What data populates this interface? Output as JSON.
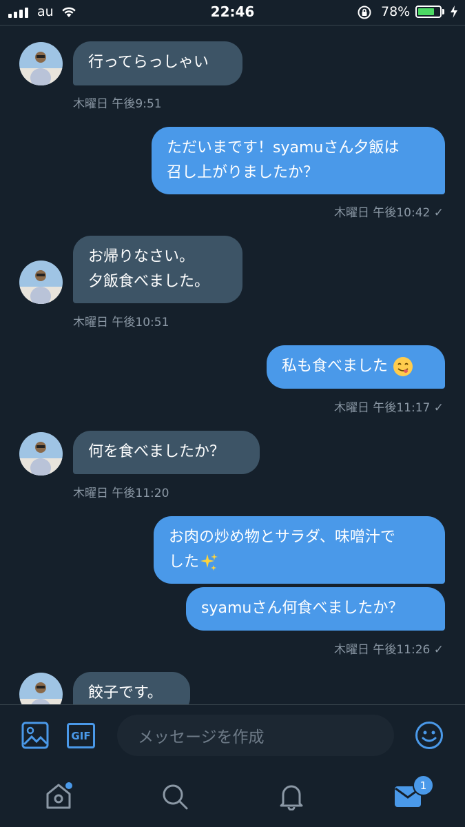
{
  "status_bar": {
    "carrier": "au",
    "time": "22:46",
    "battery": "78%",
    "battery_level": 0.78
  },
  "messages": [
    {
      "side": "in",
      "lines": [
        "行ってらっしゃい"
      ],
      "timestamp": "木曜日 午後9:51"
    },
    {
      "side": "out",
      "lines": [
        "ただいまです！syamuさん夕飯は",
        "召し上がりましたか？"
      ],
      "timestamp": "木曜日 午後10:42 ✓"
    },
    {
      "side": "in",
      "lines": [
        "お帰りなさい。",
        "夕飯食べました。"
      ],
      "timestamp": "木曜日 午後10:51"
    },
    {
      "side": "out",
      "lines": [
        "私も食べました"
      ],
      "emoji": "savoring-face-emoji",
      "timestamp": "木曜日 午後11:17 ✓"
    },
    {
      "side": "in",
      "lines": [
        "何を食べましたか？"
      ],
      "timestamp": "木曜日 午後11:20"
    },
    {
      "side": "out",
      "lines": [
        "お肉の炒め物とサラダ、味噌汁で",
        "した"
      ],
      "emoji": "sparkles-emoji"
    },
    {
      "side": "out",
      "lines": [
        "syamuさん何食べましたか？"
      ],
      "timestamp": "木曜日 午後11:26 ✓"
    },
    {
      "side": "in",
      "lines": [
        "餃子です。"
      ]
    }
  ],
  "composer": {
    "placeholder": "メッセージを作成",
    "gif_label": "GIF"
  },
  "tabbar": {
    "messages_badge": "1"
  },
  "colors": {
    "background": "#15202b",
    "incoming_bubble": "#3d5466",
    "outgoing_bubble": "#4a99e9",
    "accent": "#4a99e9",
    "timestamp": "#8b98a5"
  }
}
